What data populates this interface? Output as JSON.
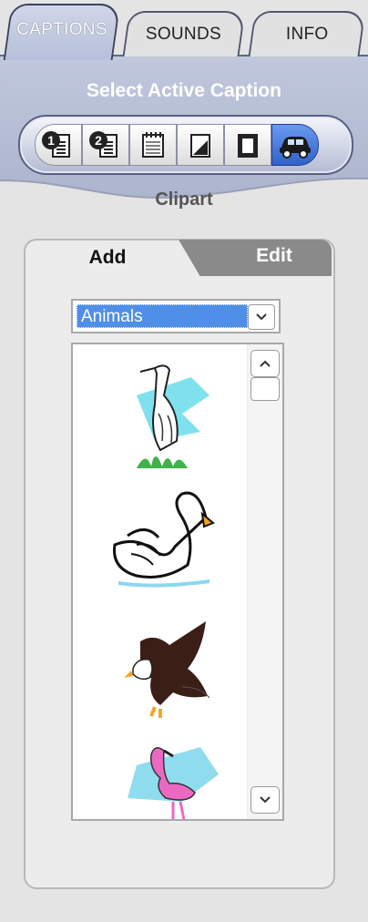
{
  "tabs": [
    {
      "label": "CAPTIONS",
      "active": true
    },
    {
      "label": "SOUNDS",
      "active": false
    },
    {
      "label": "INFO",
      "active": false
    }
  ],
  "header": {
    "title": "Select Active Caption",
    "caption_buttons": [
      {
        "icon": "caption-1-icon"
      },
      {
        "icon": "caption-2-icon"
      },
      {
        "icon": "calendar-caption-icon"
      },
      {
        "icon": "picture-caption-icon"
      },
      {
        "icon": "frame-caption-icon"
      },
      {
        "icon": "car-clipart-icon",
        "active": true
      }
    ],
    "section_label": "Clipart"
  },
  "panel": {
    "tabs": [
      {
        "label": "Add",
        "active": true
      },
      {
        "label": "Edit",
        "active": false
      }
    ],
    "category_select": {
      "value": "Animals"
    },
    "clipart_items": [
      {
        "icon": "heron-clipart"
      },
      {
        "icon": "swan-clipart"
      },
      {
        "icon": "eagle-clipart"
      },
      {
        "icon": "flamingo-clipart"
      }
    ]
  },
  "colors": {
    "accent": "#2f62c9",
    "header_bg": "#b5bdd5",
    "selection": "#4f8fe8"
  }
}
